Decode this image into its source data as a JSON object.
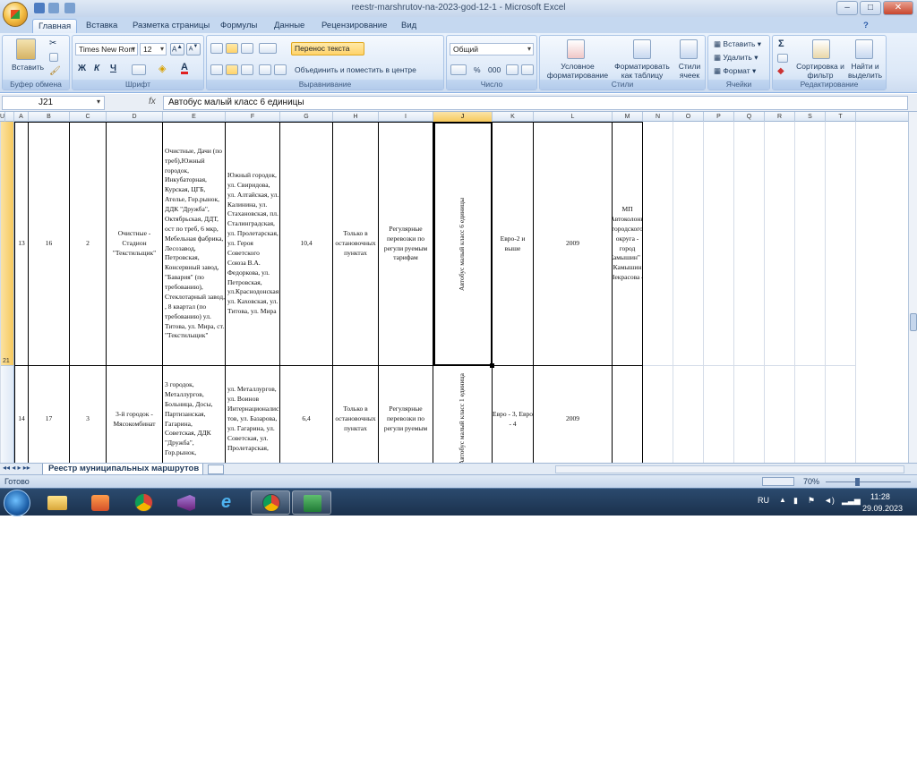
{
  "window": {
    "title": "reestr-marshrutov-na-2023-god-12-1 - Microsoft Excel",
    "min": "–",
    "max": "□",
    "close": "✕"
  },
  "ribbon_tabs": [
    "Главная",
    "Вставка",
    "Разметка страницы",
    "Формулы",
    "Данные",
    "Рецензирование",
    "Вид"
  ],
  "ribbon": {
    "clipboard": {
      "paste": "Вставить",
      "label": "Буфер обмена"
    },
    "font": {
      "name": "Times New Rom",
      "size": "12",
      "bold": "Ж",
      "italic": "К",
      "underline": "Ч",
      "label": "Шрифт"
    },
    "alignment": {
      "wrap": "Перенос текста",
      "merge": "Объединить и поместить в центре",
      "label": "Выравнивание"
    },
    "number": {
      "format": "Общий",
      "percent": "%",
      "thousands": "000",
      "label": "Число"
    },
    "styles": {
      "conditional": "Условное форматирование",
      "as_table": "Форматировать как таблицу",
      "cell_styles": "Стили ячеек",
      "label": "Стили"
    },
    "cells": {
      "insert": "Вставить",
      "delete": "Удалить",
      "format": "Формат",
      "label": "Ячейки"
    },
    "editing": {
      "sum": "Σ",
      "sort": "Сортировка и фильтр",
      "find": "Найти и выделить",
      "label": "Редактирование"
    }
  },
  "formula_bar": {
    "name_box": "J21",
    "fx": "fx",
    "content": "Автобус малый класс 6 единицы"
  },
  "columns": [
    "A",
    "B",
    "C",
    "D",
    "E",
    "F",
    "G",
    "H",
    "I",
    "J",
    "K",
    "L",
    "M",
    "N",
    "O",
    "P",
    "Q",
    "R",
    "S",
    "T",
    "U"
  ],
  "rows": [
    {
      "header": "21",
      "A": "13",
      "B": "16",
      "C": "2",
      "D": "Очистные - Стадион \"Текстильщик\"",
      "E": "Очистные, Дачи (по треб),Южный городок, Инкубаторная, Курская, ЦГБ, Ателье, Гор.рынок, ДДК \"Дружба\", Октябрьская, ДДТ, ост по треб, 6 мкр, Мебельная фабрика, Лесозавод, Петровская, Консервный завод, \"Бавария\" (по требованию), Стеклотарный завод, , 8 квартал (по требованию) ул. Титова, ул. Мира, ст. \"Текстильщик\"",
      "F": "Южный городок, ул. Свиридова, ул. Алтайская, ул. Калинина, ул. Стахановская, пл. Сталинградская, ул. Пролетарская, ул. Героя Советского Союза В.А. Федоркова, ул. Петровская, ул.Краснодонская ул. Каховская, ул. Титова, ул. Мира",
      "G": "10,4",
      "H": "Только в остановочных пунктах",
      "I": "Регулярные перевозки по регули руемым тарифам",
      "J": "Автобус малый класс 6 единицы",
      "K": "Евро-2 и выше",
      "L": "2009",
      "M": "МП \"Автоколонна городского округа - город Камышин\" г. Камышин Некрасова 4"
    },
    {
      "header": "",
      "A": "14",
      "B": "17",
      "C": "3",
      "D": "3-й городок - Мясокомбинат",
      "E": "3 городок, Металлургов, Больница, Досы, Партизанская, Гагарина, Советская, ДДК \"Дружба\", Гор.рынок,",
      "F": "ул. Металлургов, ул. Воинов Интернационалис тов, ул. Базарова, ул. Гагарина, ул. Советская, ул. Пролетарская,",
      "G": "6,4",
      "H": "Только в остановочных пунктах",
      "I": "Регулярные перевозки по регули руемым",
      "J": "Автобус малый класс 1 единица",
      "K": "Евро - 3, Евро - 4",
      "L": "2009",
      "M": ""
    }
  ],
  "sheet_tab": "Реестр муниципальных маршрутов",
  "status": {
    "ready": "Готово",
    "zoom": "70%"
  },
  "taskbar": {
    "lang": "RU",
    "time": "11:28",
    "date": "29.09.2023"
  }
}
